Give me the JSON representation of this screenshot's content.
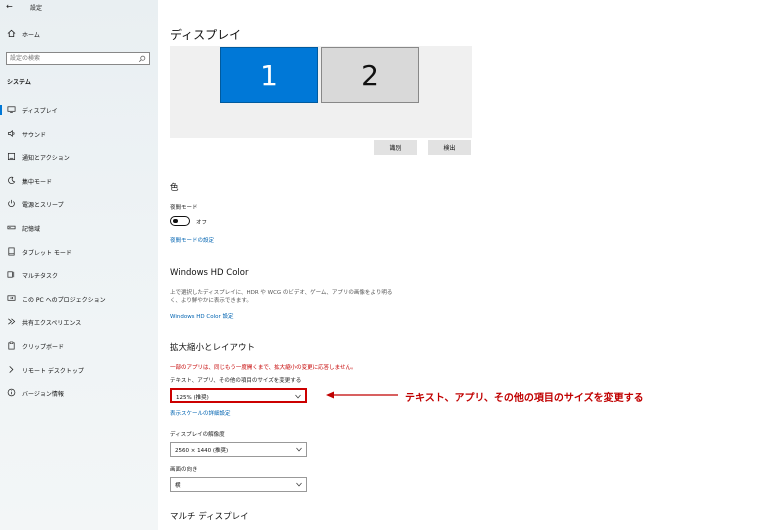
{
  "window": {
    "title": "設定"
  },
  "sidebar": {
    "home_label": "ホーム",
    "search_placeholder": "設定の検索",
    "section": "システム",
    "items": [
      {
        "label": "ディスプレイ",
        "icon": "monitor-icon",
        "active": true
      },
      {
        "label": "サウンド",
        "icon": "speaker-icon"
      },
      {
        "label": "通知とアクション",
        "icon": "notification-icon"
      },
      {
        "label": "集中モード",
        "icon": "moon-icon"
      },
      {
        "label": "電源とスリープ",
        "icon": "power-icon"
      },
      {
        "label": "記憶域",
        "icon": "storage-icon"
      },
      {
        "label": "タブレット モード",
        "icon": "tablet-icon"
      },
      {
        "label": "マルチタスク",
        "icon": "multitask-icon"
      },
      {
        "label": "この PC へのプロジェクション",
        "icon": "projection-icon"
      },
      {
        "label": "共有エクスペリエンス",
        "icon": "share-icon"
      },
      {
        "label": "クリップボード",
        "icon": "clipboard-icon"
      },
      {
        "label": "リモート デスクトップ",
        "icon": "remote-icon"
      },
      {
        "label": "バージョン情報",
        "icon": "info-icon"
      }
    ]
  },
  "main": {
    "title": "ディスプレイ",
    "monitors": [
      "1",
      "2"
    ],
    "identify_label": "識別",
    "detect_label": "検出",
    "color": {
      "heading": "色",
      "night_light_label": "夜間モード",
      "night_light_state": "オフ",
      "night_light_link": "夜間モードの設定"
    },
    "hdr": {
      "heading": "Windows HD Color",
      "description": "上で選択したディスプレイに、HDR や WCG のビデオ、ゲーム、アプリの画像をより明るく、より鮮やかに表示できます。",
      "link": "Windows HD Color 設定"
    },
    "scale": {
      "heading": "拡大縮小とレイアウト",
      "warning": "一部のアプリは、同じもう一度開くまで、拡大縮小の変更に応答しません。",
      "size_label": "テキスト、アプリ、その他の項目のサイズを変更する",
      "size_value": "125% (推奨)",
      "advanced_link": "表示スケールの詳細設定",
      "resolution_label": "ディスプレイの解像度",
      "resolution_value": "2560 × 1440 (推奨)",
      "orientation_label": "画面の向き",
      "orientation_value": "横"
    },
    "multi_display_heading": "マルチ ディスプレイ"
  },
  "annotation": {
    "text": "テキスト、アプリ、その他の項目のサイズを変更する",
    "color": "#c00000"
  },
  "colors": {
    "accent": "#0078d7",
    "link": "#0063b1",
    "warning": "#c50000"
  }
}
